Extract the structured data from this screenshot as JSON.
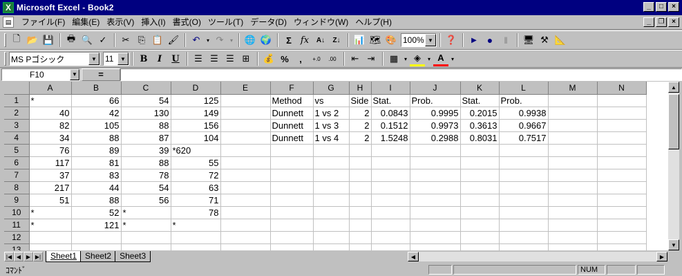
{
  "window": {
    "title": "Microsoft Excel - Book2"
  },
  "menu": [
    "ファイル(F)",
    "編集(E)",
    "表示(V)",
    "挿入(I)",
    "書式(O)",
    "ツール(T)",
    "データ(D)",
    "ウィンドウ(W)",
    "ヘルプ(H)"
  ],
  "toolbar": {
    "zoom": "100%"
  },
  "format": {
    "font": "MS Pゴシック",
    "size": "11"
  },
  "formula": {
    "cell_ref": "F10",
    "eq": "=",
    "value": ""
  },
  "columns": [
    "A",
    "B",
    "C",
    "D",
    "E",
    "F",
    "G",
    "H",
    "I",
    "J",
    "K",
    "L",
    "M",
    "N"
  ],
  "rows": [
    {
      "n": "1",
      "c": [
        "*",
        "66",
        "54",
        "125",
        "",
        "Method",
        "vs",
        "Side",
        "Stat.",
        "Prob.",
        "Stat.",
        "Prob.",
        "",
        ""
      ]
    },
    {
      "n": "2",
      "c": [
        "40",
        "42",
        "130",
        "149",
        "",
        "Dunnett",
        "1 vs 2",
        "2",
        "0.0843",
        "0.9995",
        "0.2015",
        "0.9938",
        "",
        ""
      ]
    },
    {
      "n": "3",
      "c": [
        "82",
        "105",
        "88",
        "156",
        "",
        "Dunnett",
        "1 vs 3",
        "2",
        "0.1512",
        "0.9973",
        "0.3613",
        "0.9667",
        "",
        ""
      ]
    },
    {
      "n": "4",
      "c": [
        "34",
        "88",
        "87",
        "104",
        "",
        "Dunnett",
        "1 vs 4",
        "2",
        "1.5248",
        "0.2988",
        "0.8031",
        "0.7517",
        "",
        ""
      ]
    },
    {
      "n": "5",
      "c": [
        "76",
        "89",
        "39",
        "*620",
        "",
        "",
        "",
        "",
        "",
        "",
        "",
        "",
        "",
        ""
      ]
    },
    {
      "n": "6",
      "c": [
        "117",
        "81",
        "88",
        "55",
        "",
        "",
        "",
        "",
        "",
        "",
        "",
        "",
        "",
        ""
      ]
    },
    {
      "n": "7",
      "c": [
        "37",
        "83",
        "78",
        "72",
        "",
        "",
        "",
        "",
        "",
        "",
        "",
        "",
        "",
        ""
      ]
    },
    {
      "n": "8",
      "c": [
        "217",
        "44",
        "54",
        "63",
        "",
        "",
        "",
        "",
        "",
        "",
        "",
        "",
        "",
        ""
      ]
    },
    {
      "n": "9",
      "c": [
        "51",
        "88",
        "56",
        "71",
        "",
        "",
        "",
        "",
        "",
        "",
        "",
        "",
        "",
        ""
      ]
    },
    {
      "n": "10",
      "c": [
        "*",
        "52",
        "*",
        "78",
        "",
        "",
        "",
        "",
        "",
        "",
        "",
        "",
        "",
        ""
      ]
    },
    {
      "n": "11",
      "c": [
        "*",
        "121",
        "*",
        "*",
        "",
        "",
        "",
        "",
        "",
        "",
        "",
        "",
        "",
        ""
      ]
    },
    {
      "n": "12",
      "c": [
        "",
        "",
        "",
        "",
        "",
        "",
        "",
        "",
        "",
        "",
        "",
        "",
        "",
        ""
      ]
    },
    {
      "n": "13",
      "c": [
        "",
        "",
        "",
        "",
        "",
        "",
        "",
        "",
        "",
        "",
        "",
        "",
        "",
        ""
      ]
    }
  ],
  "sheets": [
    "Sheet1",
    "Sheet2",
    "Sheet3"
  ],
  "status": {
    "mode": "ｺﾏﾝﾄﾞ",
    "num": "NUM"
  }
}
